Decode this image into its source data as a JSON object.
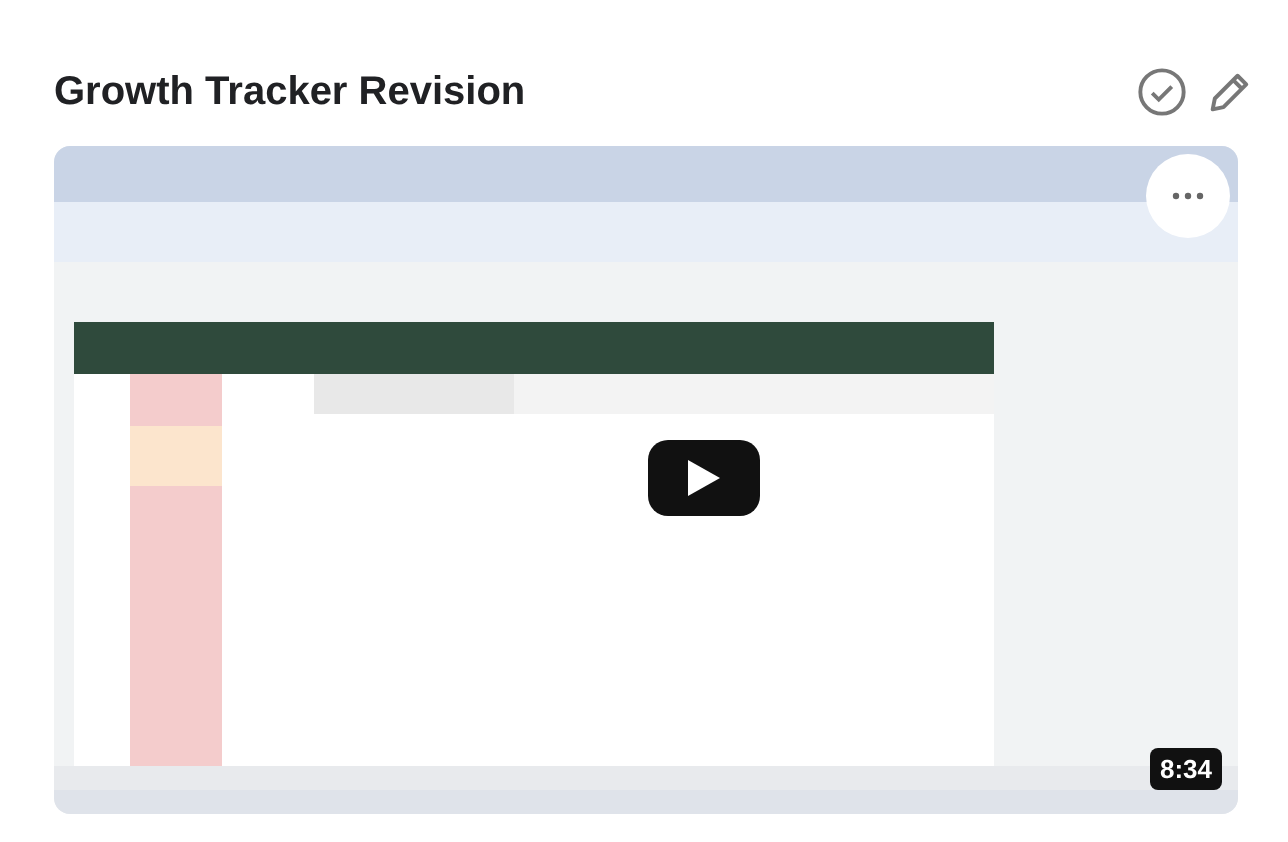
{
  "title": "Growth Tracker Revision",
  "video": {
    "duration": "8:34"
  }
}
